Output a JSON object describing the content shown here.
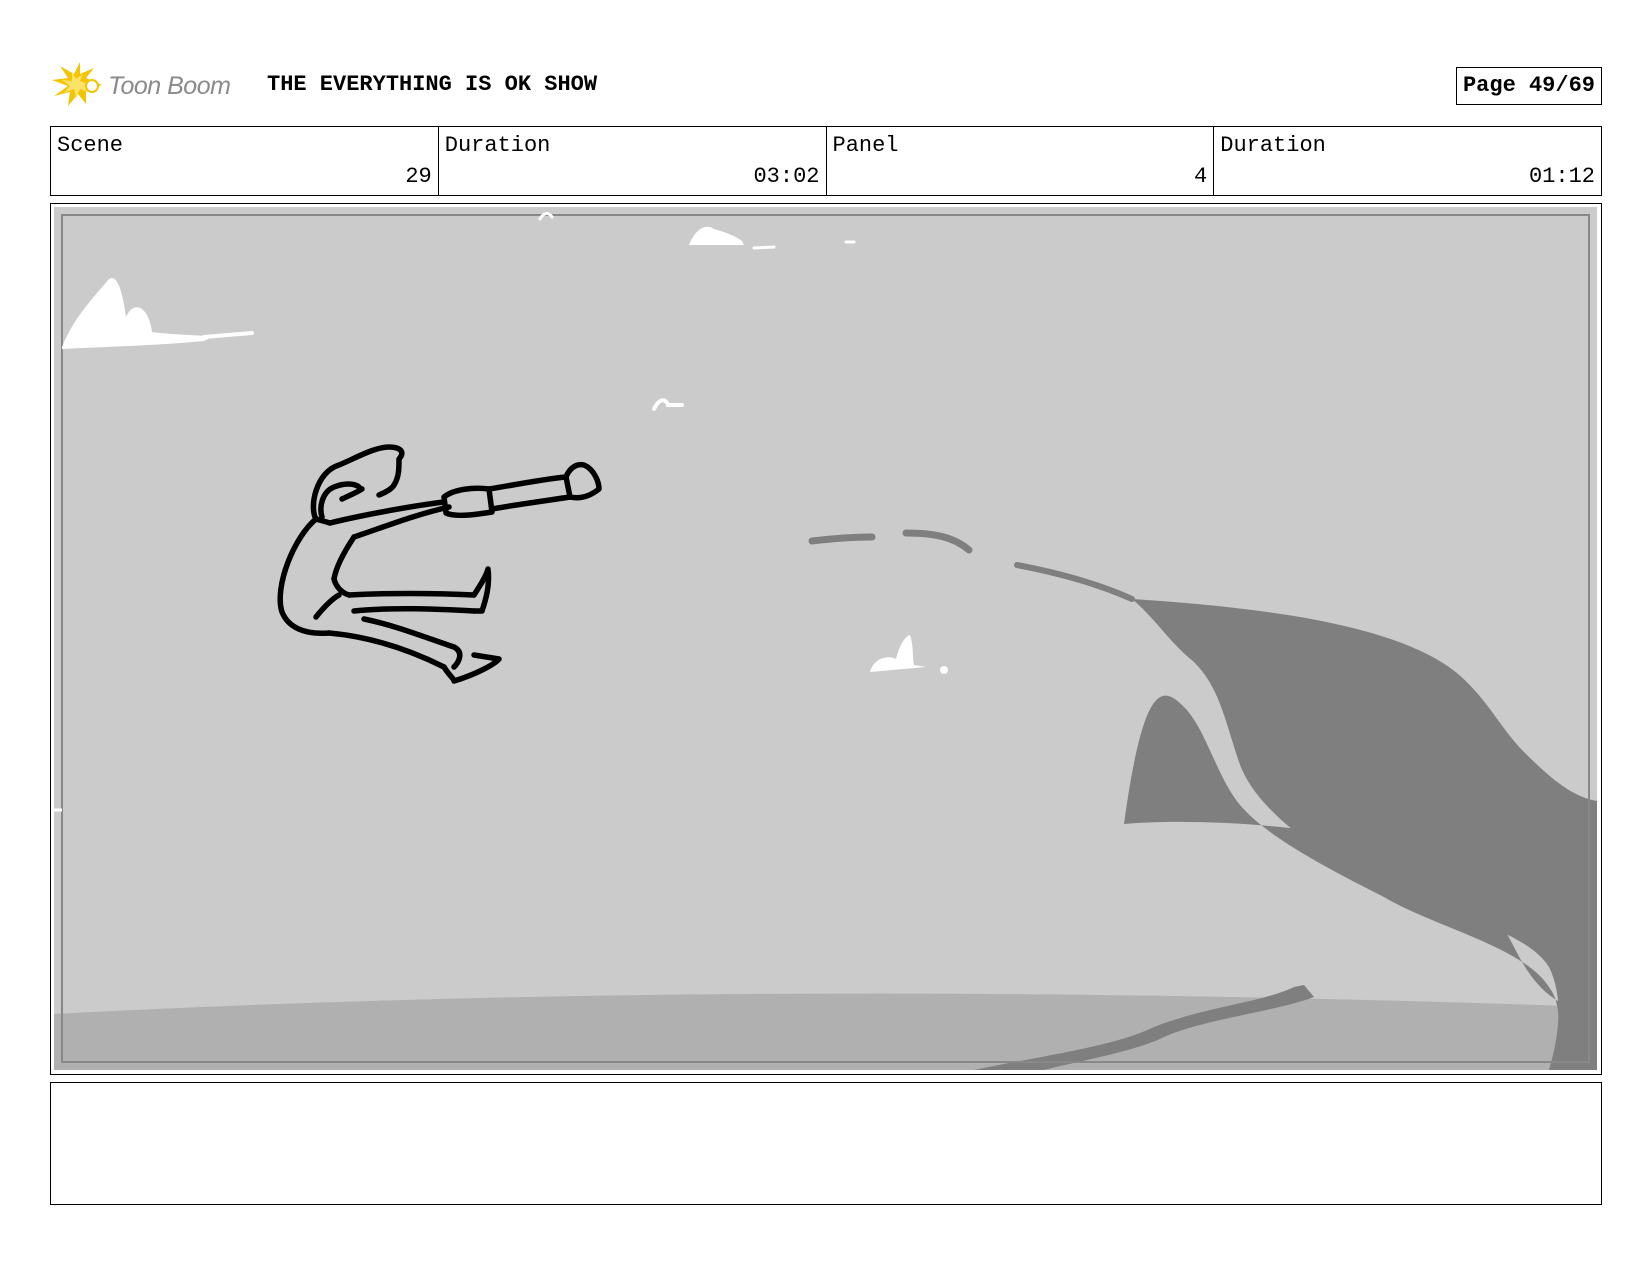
{
  "header": {
    "logo_text": "Toon Boom",
    "show_title": "THE EVERYTHING IS OK SHOW",
    "page_label": "Page 49/69"
  },
  "info": {
    "scene_label": "Scene",
    "scene_value": "29",
    "scene_duration_label": "Duration",
    "scene_duration_value": "03:02",
    "panel_label": "Panel",
    "panel_value": "4",
    "panel_duration_label": "Duration",
    "panel_duration_value": "01:12"
  },
  "notes": {
    "text": ""
  },
  "colors": {
    "sky": "#cbcbcb",
    "ground": "#b0b0b0",
    "tree": "#7f7f7f",
    "logo_accent": "#f5c400"
  }
}
